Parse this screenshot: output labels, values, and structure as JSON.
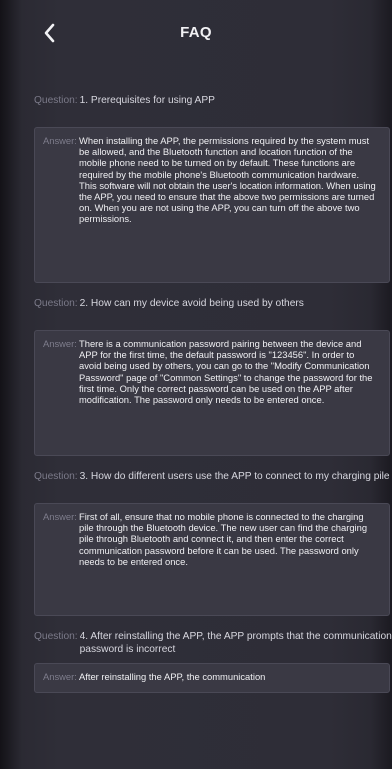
{
  "header": {
    "back_icon": "chevron-left-icon",
    "title": "FAQ"
  },
  "faq": {
    "question_prefix": "Question:",
    "answer_prefix": "Answer:",
    "items": [
      {
        "question": "1. Prerequisites for using APP",
        "answer": "When installing the APP, the permissions required by the system must be allowed, and the Bluetooth function and location function of the mobile phone need to be turned on by default. These functions are required by the mobile phone's Bluetooth communication hardware. This software will not obtain the user's location information. When using the APP, you need to ensure that the above two permissions are turned on. When you are not using the APP, you can turn off the above two permissions."
      },
      {
        "question": "2. How can my device avoid being used by others",
        "answer": "There is a communication password pairing between the device and APP for the first time, the default password is \"123456\". In order to avoid being used by others, you can go to the \"Modify Communication Password\" page of \"Common Settings\" to change the password for the first time. Only the correct password can be used on the APP after modification. The password only needs to be entered once."
      },
      {
        "question": "3. How do different users use the APP to connect to my charging pile",
        "answer": "First of all, ensure that no mobile phone is connected to the charging pile through the Bluetooth device. The new user can find the charging pile through Bluetooth and connect it, and then enter the correct communication password before it can be used. The password only needs to be entered once."
      },
      {
        "question": "4. After reinstalling the APP, the APP prompts that the communication password is incorrect",
        "answer": "After reinstalling the APP, the communication"
      }
    ]
  }
}
